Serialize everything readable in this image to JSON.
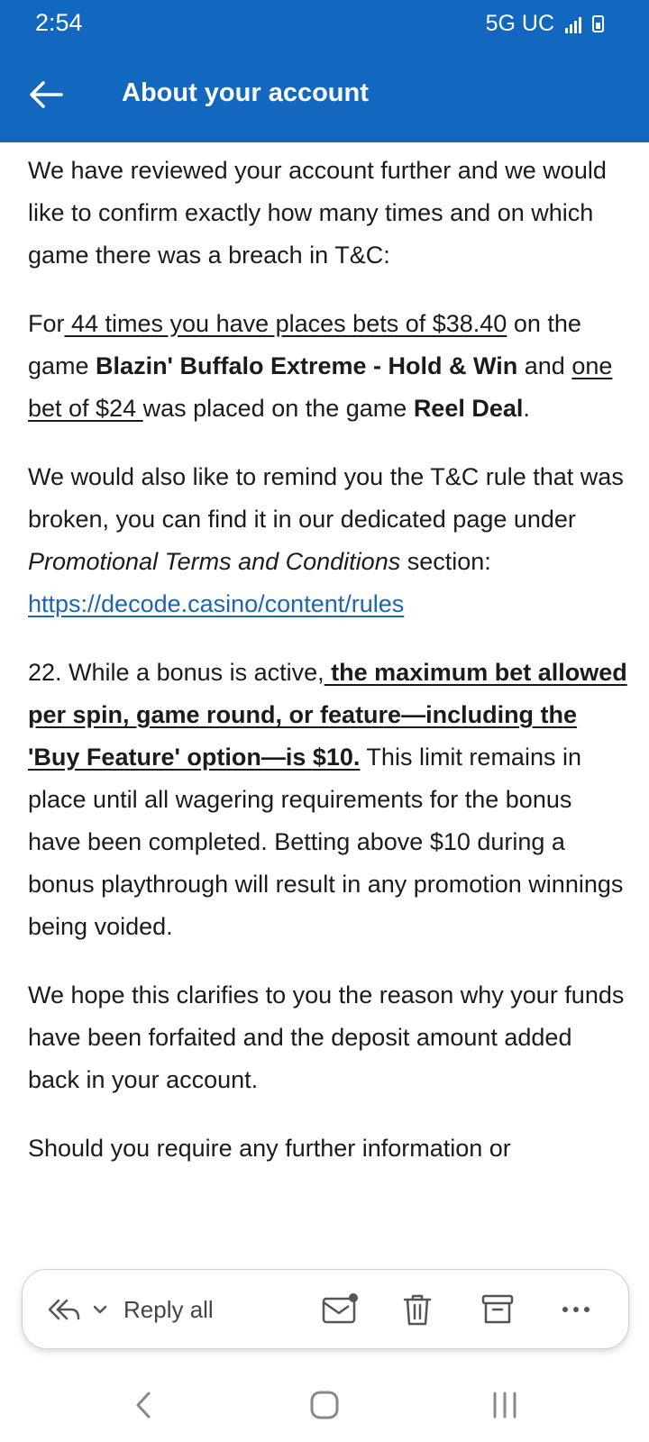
{
  "status_bar": {
    "time": "2:54",
    "network": "5G UC"
  },
  "header": {
    "title": "About your account"
  },
  "body": {
    "p1": "We have reviewed your account further and we would like to confirm exactly how many times and on which game there was a breach in T&C:",
    "p2": {
      "t1": "For",
      "u1": " 44 times you have places bets of $38.40",
      "t2": " on the game ",
      "b1": "Blazin' Buffalo Extreme - Hold & Win",
      "t3": " and ",
      "u2": "one bet of $24 ",
      "t4": "was placed on the game ",
      "b2": "Reel Deal",
      "t5": "."
    },
    "p3": {
      "t1": "We would also like to remind you the T&C rule that was broken, you can find it in our dedicated page under ",
      "i1": "Promotional Terms and Conditions",
      "t2": " section: ",
      "link": "https://decode.casino/content/rules"
    },
    "p4": {
      "t1": "22. While a bonus is active,",
      "bu": " the maximum bet allowed per spin, game round, or feature—including the 'Buy Feature' option—is $10.",
      "t2": " This limit remains in place until all wagering requirements for the bonus have been completed. Betting above $10 during a bonus playthrough will result in any promotion winnings being voided."
    },
    "p5": "We hope this clarifies to you the reason why your funds have been forfaited and the deposit amount added back in your account.",
    "p6": "Should you require any further information or"
  },
  "action_bar": {
    "reply_label": "Reply all",
    "icons": [
      "reply-all-icon",
      "chevron-down-icon",
      "mark-unread-icon",
      "trash-icon",
      "archive-icon",
      "more-icon"
    ]
  },
  "nav_bar": {
    "icons": [
      "back-nav-icon",
      "home-nav-icon",
      "recents-nav-icon"
    ]
  },
  "colors": {
    "header": "#1268bf",
    "link": "#1a66b4"
  }
}
